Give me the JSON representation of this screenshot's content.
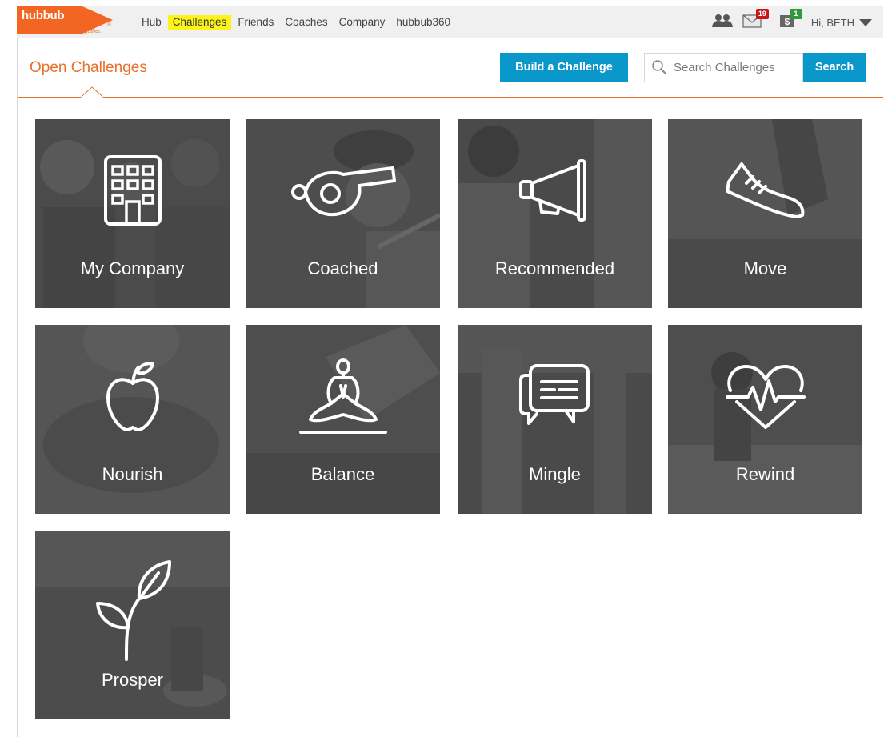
{
  "brand": {
    "name": "hubbub",
    "tagline": "play well. together.",
    "registered_mark": "®",
    "color": "#f26522"
  },
  "nav": {
    "items": [
      {
        "label": "Hub",
        "active": false
      },
      {
        "label": "Challenges",
        "active": true
      },
      {
        "label": "Friends",
        "active": false
      },
      {
        "label": "Coaches",
        "active": false
      },
      {
        "label": "Company",
        "active": false
      },
      {
        "label": "hubbub360",
        "active": false
      }
    ],
    "highlight_color": "#fbf31a"
  },
  "user_area": {
    "friends_icon": "people-icon",
    "messages_icon": "envelope-icon",
    "messages_count": "19",
    "rewards_icon": "dollar-icon",
    "rewards_count": "1",
    "greeting": "Hi, BETH",
    "menu_icon": "caret-down-icon"
  },
  "header": {
    "title": "Open Challenges",
    "build_button": "Build a Challenge",
    "search_placeholder": "Search Challenges",
    "search_button": "Search",
    "accent_color": "#e8702a",
    "button_color": "#0a97c9"
  },
  "tiles": [
    {
      "label": "My Company",
      "icon": "building-icon"
    },
    {
      "label": "Coached",
      "icon": "whistle-icon"
    },
    {
      "label": "Recommended",
      "icon": "megaphone-icon"
    },
    {
      "label": "Move",
      "icon": "sneaker-icon"
    },
    {
      "label": "Nourish",
      "icon": "apple-icon"
    },
    {
      "label": "Balance",
      "icon": "meditation-icon"
    },
    {
      "label": "Mingle",
      "icon": "chat-bubbles-icon"
    },
    {
      "label": "Rewind",
      "icon": "heartbeat-icon"
    },
    {
      "label": "Prosper",
      "icon": "sprout-icon"
    }
  ]
}
